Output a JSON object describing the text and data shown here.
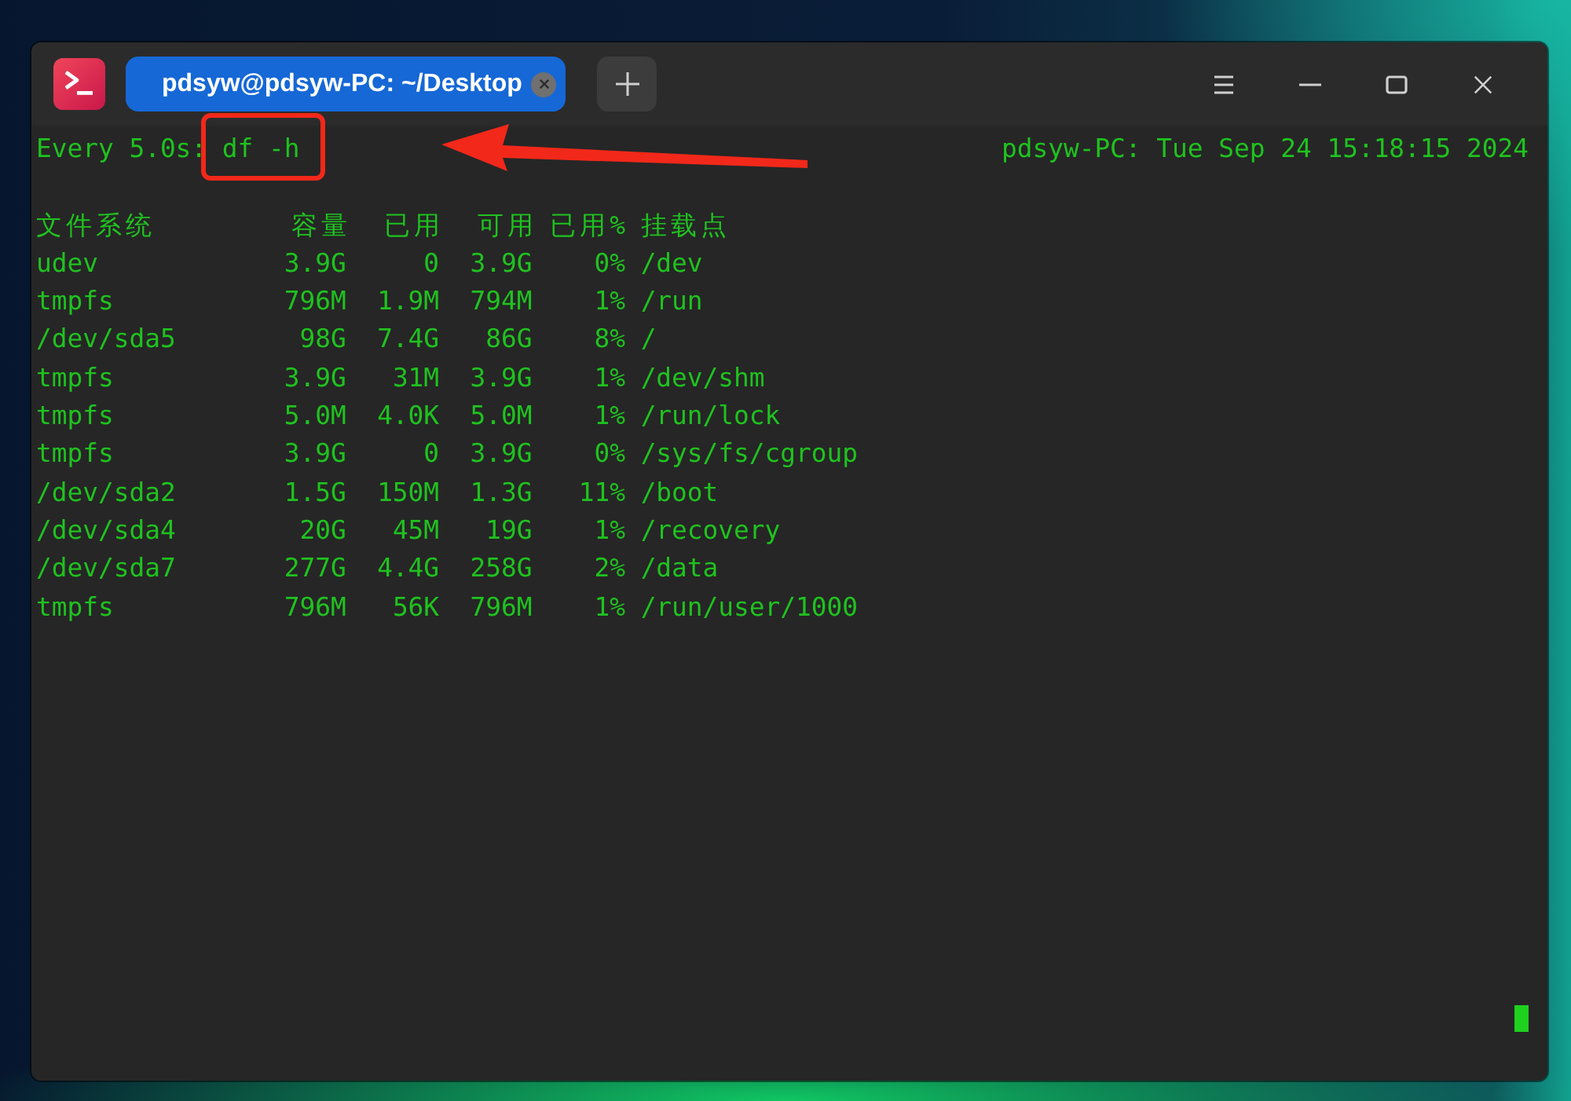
{
  "tabs": [
    {
      "label": "pdsyw@pdsyw-PC: ~/Desktop",
      "selected": true
    }
  ],
  "watch": {
    "interval": "Every 5.0s:",
    "command": "df -h",
    "host_time": "pdsyw-PC: Tue Sep 24 15:18:15 2024"
  },
  "annotation": {
    "command_highlighted": true,
    "arrow": true
  },
  "table": {
    "columns": [
      "文件系统",
      "容量",
      "已用",
      "可用",
      "已用%",
      "挂载点"
    ],
    "rows": [
      [
        "udev",
        "3.9G",
        "0",
        "3.9G",
        "0%",
        "/dev"
      ],
      [
        "tmpfs",
        "796M",
        "1.9M",
        "794M",
        "1%",
        "/run"
      ],
      [
        "/dev/sda5",
        "98G",
        "7.4G",
        "86G",
        "8%",
        "/"
      ],
      [
        "tmpfs",
        "3.9G",
        "31M",
        "3.9G",
        "1%",
        "/dev/shm"
      ],
      [
        "tmpfs",
        "5.0M",
        "4.0K",
        "5.0M",
        "1%",
        "/run/lock"
      ],
      [
        "tmpfs",
        "3.9G",
        "0",
        "3.9G",
        "0%",
        "/sys/fs/cgroup"
      ],
      [
        "/dev/sda2",
        "1.5G",
        "150M",
        "1.3G",
        "11%",
        "/boot"
      ],
      [
        "/dev/sda4",
        "20G",
        "45M",
        "19G",
        "1%",
        "/recovery"
      ],
      [
        "/dev/sda7",
        "277G",
        "4.4G",
        "258G",
        "2%",
        "/data"
      ],
      [
        "tmpfs",
        "796M",
        "56K",
        "796M",
        "1%",
        "/run/user/1000"
      ]
    ]
  }
}
